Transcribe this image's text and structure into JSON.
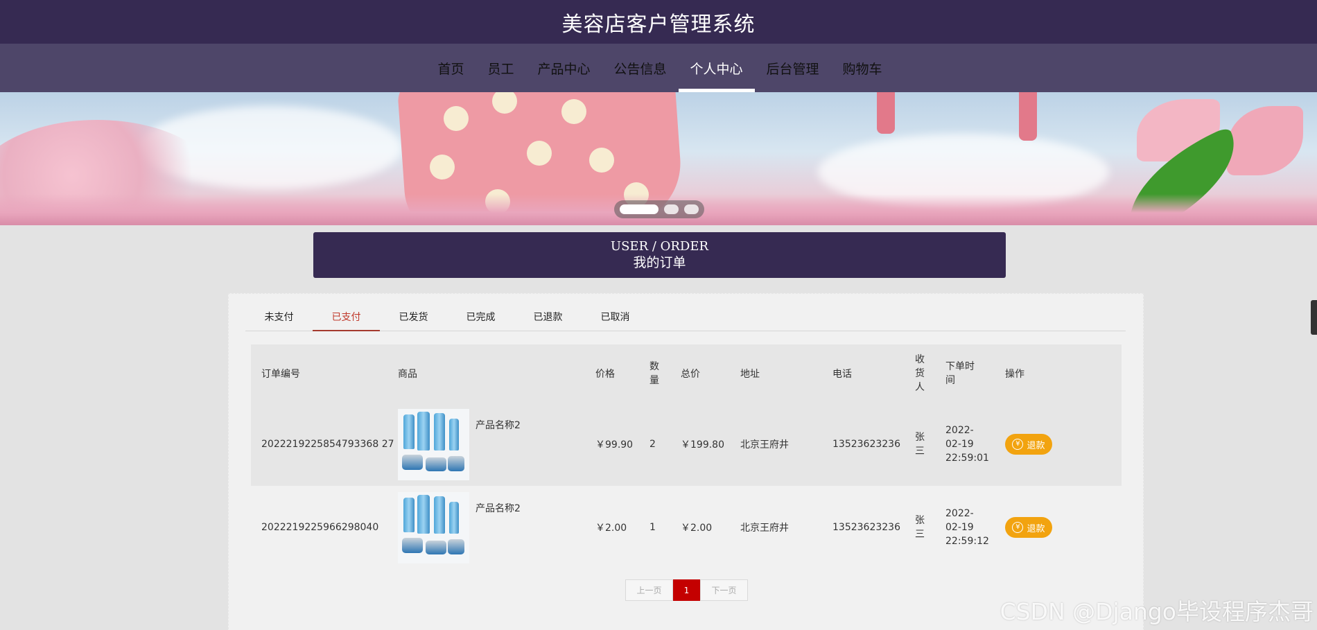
{
  "site": {
    "title": "美容店客户管理系统"
  },
  "nav": {
    "items": [
      {
        "label": "首页"
      },
      {
        "label": "员工"
      },
      {
        "label": "产品中心"
      },
      {
        "label": "公告信息"
      },
      {
        "label": "个人中心",
        "active": true
      },
      {
        "label": "后台管理"
      },
      {
        "label": "购物车"
      }
    ]
  },
  "section": {
    "title_en": "USER / ORDER",
    "title_cn": "我的订单"
  },
  "tabs": [
    {
      "label": "未支付"
    },
    {
      "label": "已支付",
      "active": true
    },
    {
      "label": "已发货"
    },
    {
      "label": "已完成"
    },
    {
      "label": "已退款"
    },
    {
      "label": "已取消"
    }
  ],
  "table": {
    "headers": {
      "order_no": "订单编号",
      "product": "商品",
      "price": "价格",
      "qty": "数量",
      "total": "总价",
      "address": "地址",
      "phone": "电话",
      "receiver": "收货人",
      "time": "下单时间",
      "action": "操作"
    },
    "rows": [
      {
        "order_no": "2022219225854793368 27",
        "product_name": "产品名称2",
        "price": "￥99.90",
        "qty": "2",
        "total": "￥199.80",
        "address": "北京王府井",
        "phone": "13523623236",
        "receiver": "张三",
        "time": "2022-02-19 22:59:01",
        "action": "退款"
      },
      {
        "order_no": "2022219225966298040",
        "product_name": "产品名称2",
        "price": "￥2.00",
        "qty": "1",
        "total": "￥2.00",
        "address": "北京王府井",
        "phone": "13523623236",
        "receiver": "张三",
        "time": "2022-02-19 22:59:12",
        "action": "退款"
      }
    ]
  },
  "pager": {
    "prev": "上一页",
    "current": "1",
    "next": "下一页"
  },
  "watermark": "CSDN @Django毕设程序杰哥",
  "colors": {
    "header": "#362a52",
    "nav": "#4e4669",
    "accent": "#c40000",
    "button": "#f2a30f"
  }
}
